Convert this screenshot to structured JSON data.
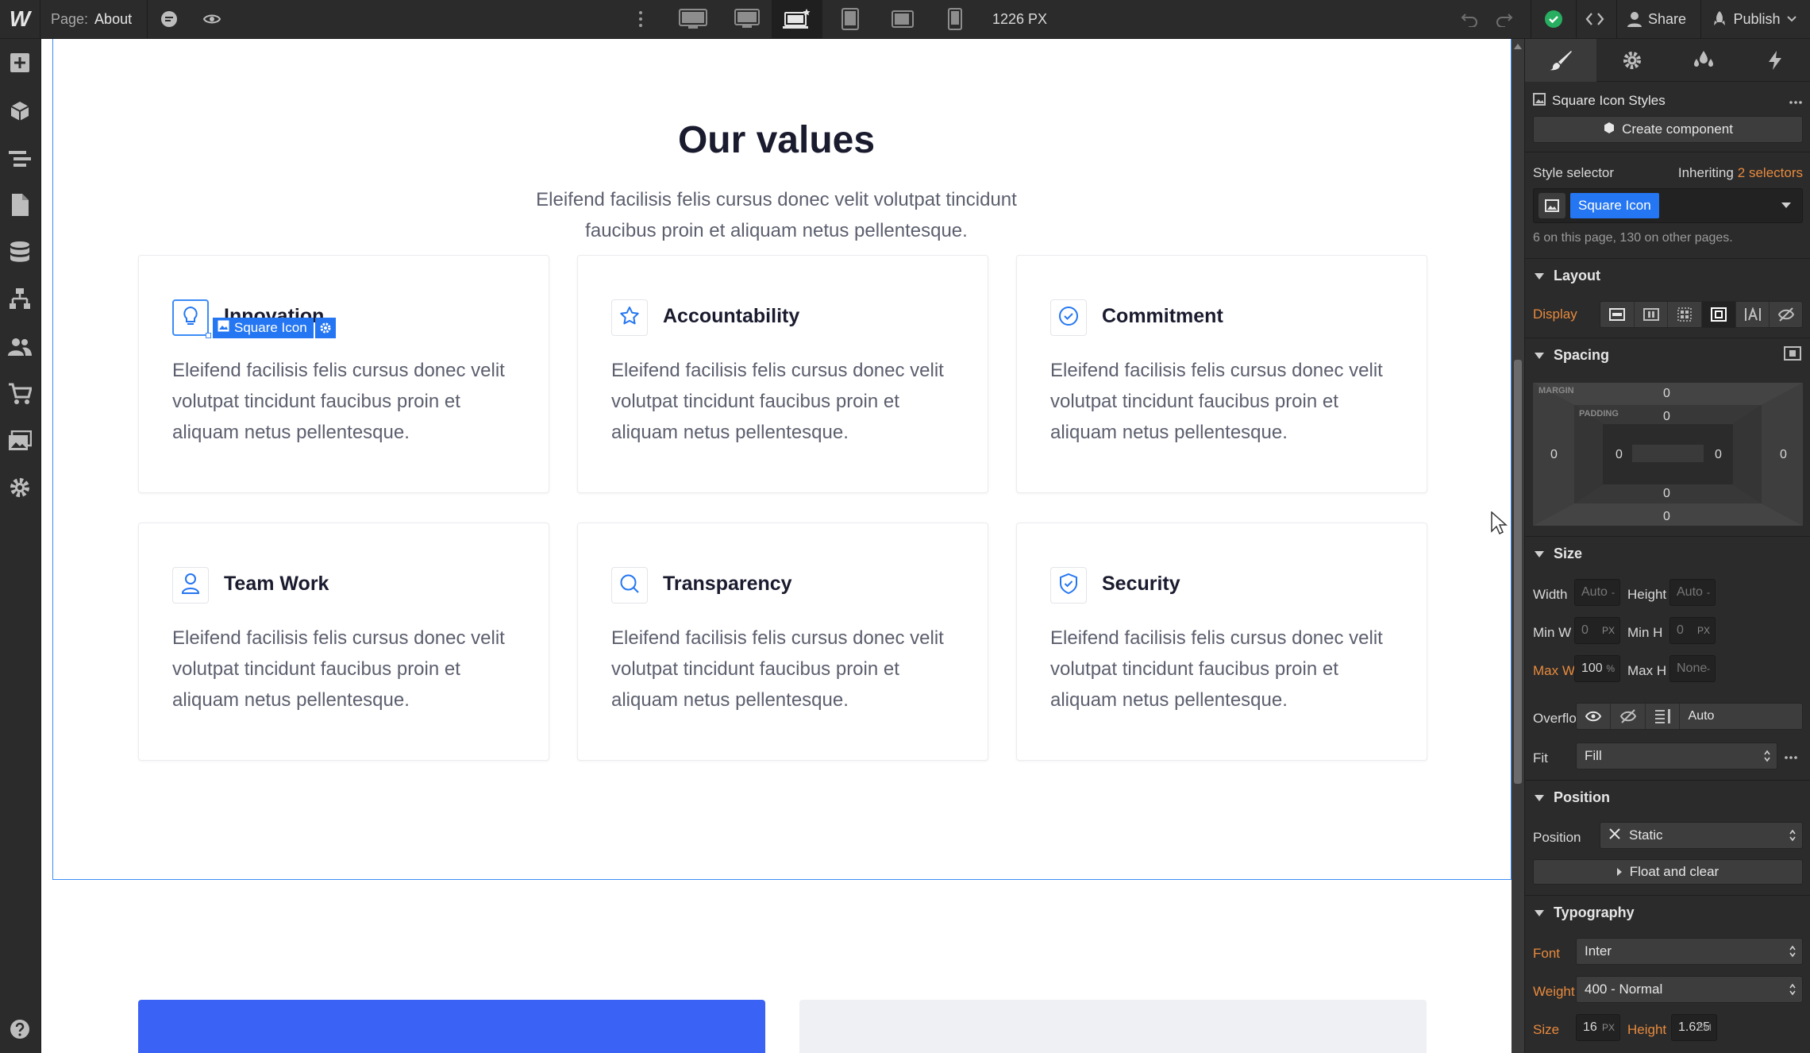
{
  "topbar": {
    "logo": "W",
    "page_prefix": "Page:",
    "page_name": "About",
    "viewport_width": "1226 PX",
    "share_label": "Share",
    "publish_label": "Publish"
  },
  "canvas": {
    "heading": "Our values",
    "lead": "Eleifend facilisis felis cursus donec velit volutpat tincidunt faucibus proin et aliquam netus  pellentesque.",
    "selection_tag": "Square Icon",
    "cards": [
      {
        "title": "Innovation",
        "icon": "lightbulb-icon",
        "body": "Eleifend facilisis felis cursus donec velit volutpat tincidunt faucibus proin et aliquam netus  pellentesque."
      },
      {
        "title": "Accountability",
        "icon": "star-icon",
        "body": "Eleifend facilisis felis cursus donec velit volutpat tincidunt faucibus proin et aliquam netus  pellentesque."
      },
      {
        "title": "Commitment",
        "icon": "check-circle-icon",
        "body": "Eleifend facilisis felis cursus donec velit volutpat tincidunt faucibus proin et aliquam netus  pellentesque."
      },
      {
        "title": "Team Work",
        "icon": "user-icon",
        "body": "Eleifend facilisis felis cursus donec velit volutpat tincidunt faucibus proin et aliquam netus  pellentesque."
      },
      {
        "title": "Transparency",
        "icon": "search-icon",
        "body": "Eleifend facilisis felis cursus donec velit volutpat tincidunt faucibus proin et aliquam netus  pellentesque."
      },
      {
        "title": "Security",
        "icon": "shield-check-icon",
        "body": "Eleifend facilisis felis cursus donec velit volutpat tincidunt faucibus proin et aliquam netus  pellentesque."
      }
    ]
  },
  "panel": {
    "element_title": "Square Icon Styles",
    "create_component": "Create component",
    "style_selector_label": "Style selector",
    "inheriting_prefix": "Inheriting",
    "inheriting_link": "2 selectors",
    "selector_chip": "Square Icon",
    "usage_note": "6 on this page, 130 on other pages.",
    "layout": {
      "title": "Layout",
      "display_label": "Display"
    },
    "spacing": {
      "title": "Spacing",
      "margin_label": "MARGIN",
      "padding_label": "PADDING",
      "margin": {
        "top": "0",
        "right": "0",
        "bottom": "0",
        "left": "0"
      },
      "padding": {
        "top": "0",
        "right": "0",
        "bottom": "0",
        "left": "0"
      }
    },
    "size": {
      "title": "Size",
      "width_label": "Width",
      "width_value": "Auto",
      "height_label": "Height",
      "height_value": "Auto",
      "minw_label": "Min W",
      "minw_value": "0",
      "minw_unit": "PX",
      "minh_label": "Min H",
      "minh_value": "0",
      "minh_unit": "PX",
      "maxw_label": "Max W",
      "maxw_value": "100",
      "maxw_unit": "%",
      "maxh_label": "Max H",
      "maxh_value": "None",
      "auto_unit": "-",
      "overflow_label": "Overflow",
      "overflow_auto": "Auto",
      "fit_label": "Fit",
      "fit_value": "Fill"
    },
    "position": {
      "title": "Position",
      "position_label": "Position",
      "position_value": "Static",
      "float_label": "Float and clear"
    },
    "typography": {
      "title": "Typography",
      "font_label": "Font",
      "font_value": "Inter",
      "weight_label": "Weight",
      "weight_value": "400 - Normal",
      "size_label": "Size",
      "size_value": "16",
      "size_unit": "PX",
      "height_label": "Height",
      "height_value": "1.625",
      "height_unit": "EM"
    }
  },
  "colors": {
    "accent": "#2476f2",
    "orange": "#e88a3d",
    "success": "#27ae60",
    "blue_block": "#3a63f6",
    "gray_block": "#eef0f4"
  }
}
